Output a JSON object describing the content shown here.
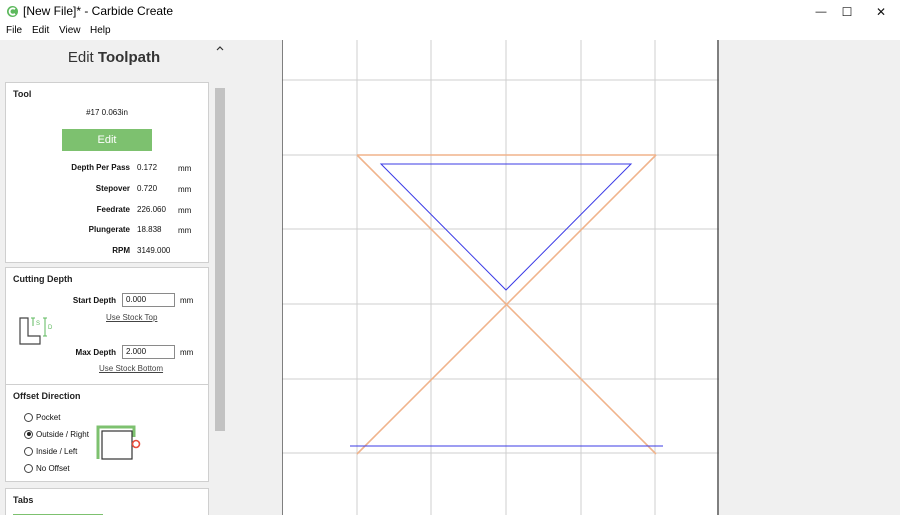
{
  "window": {
    "title": "[New File]* - Carbide Create",
    "controls": {
      "minimize": "—",
      "maximize": "☐",
      "close": "✕"
    }
  },
  "menu": [
    "File",
    "Edit",
    "View",
    "Help"
  ],
  "panel": {
    "title_light": "Edit",
    "title_bold": "Toolpath",
    "tool": {
      "heading": "Tool",
      "tool_name": "#17 0.063in",
      "edit_label": "Edit",
      "params": [
        {
          "label": "Depth Per Pass",
          "value": "0.172",
          "unit": "mm"
        },
        {
          "label": "Stepover",
          "value": "0.720",
          "unit": "mm"
        },
        {
          "label": "Feedrate",
          "value": "226.060",
          "unit": "mm"
        },
        {
          "label": "Plungerate",
          "value": "18.838",
          "unit": "mm"
        },
        {
          "label": "RPM",
          "value": "3149.000",
          "unit": ""
        }
      ]
    },
    "cutting_depth": {
      "heading": "Cutting Depth",
      "start_label": "Start Depth",
      "start_value": "0.000",
      "start_unit": "mm",
      "use_stock_top": "Use Stock Top",
      "max_label": "Max Depth",
      "max_value": "2.000",
      "max_unit": "mm",
      "use_stock_bottom": "Use Stock Bottom",
      "diagram_labels": [
        "S",
        "D"
      ]
    },
    "offset_direction": {
      "heading": "Offset Direction",
      "options": [
        {
          "label": "Pocket",
          "selected": false
        },
        {
          "label": "Outside / Right",
          "selected": true
        },
        {
          "label": "Inside / Left",
          "selected": false
        },
        {
          "label": "No Offset",
          "selected": false
        }
      ]
    },
    "tabs": {
      "heading": "Tabs"
    }
  },
  "colors": {
    "accent_green": "#7dc16f",
    "toolpath_orange": "#f0b48c",
    "offset_blue": "#3b3be6",
    "grid_gray": "#cfcfcf"
  }
}
